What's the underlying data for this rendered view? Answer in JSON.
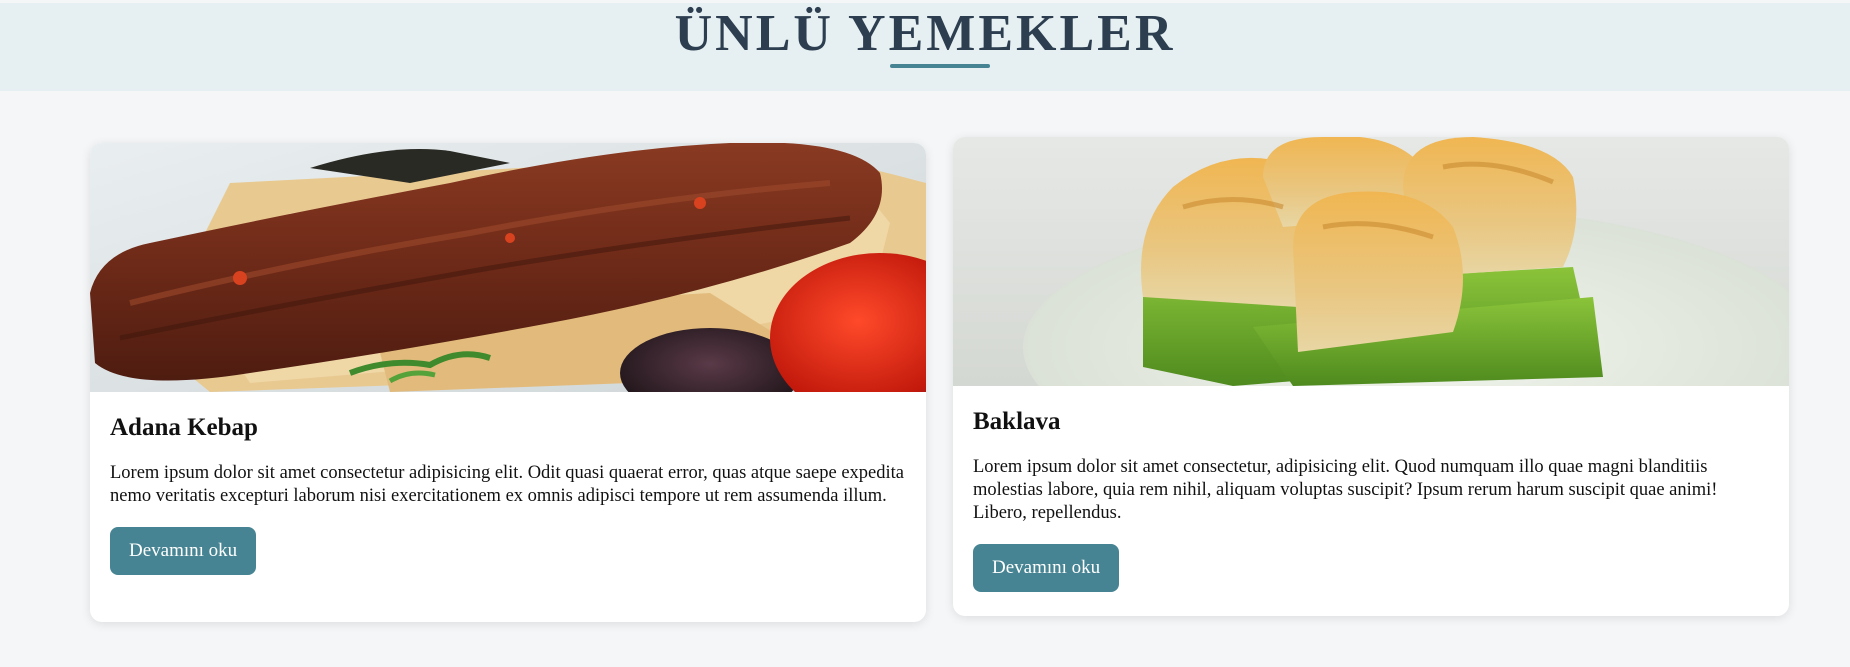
{
  "header": {
    "title": "ÜNLÜ YEMEKLER"
  },
  "colors": {
    "accent": "#468493",
    "title": "#2c3e50",
    "header_bg": "#e6f0f2",
    "page_bg": "#f4f6f8"
  },
  "cards": [
    {
      "image": "adana-kebap-photo",
      "title": "Adana Kebap",
      "text": "Lorem ipsum dolor sit amet consectetur adipisicing elit. Odit quasi quaerat error, quas atque saepe expedita nemo veritatis excepturi laborum nisi exercitationem ex omnis adipisci tempore ut rem assumenda illum.",
      "button": "Devamını oku"
    },
    {
      "image": "baklava-photo",
      "title": "Baklava",
      "text": "Lorem ipsum dolor sit amet consectetur, adipisicing elit. Quod numquam illo quae magni blanditiis molestias labore, quia rem nihil, aliquam voluptas suscipit? Ipsum rerum harum suscipit quae animi! Libero, repellendus.",
      "button": "Devamını oku"
    }
  ]
}
